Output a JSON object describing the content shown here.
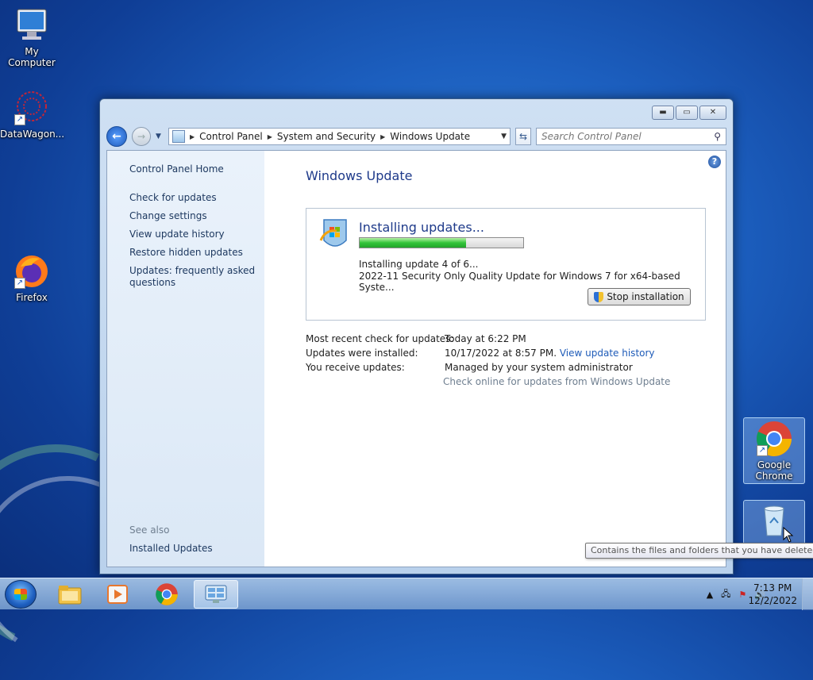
{
  "desktop": {
    "icons": [
      {
        "label": "My Computer",
        "icon": "computer-icon"
      },
      {
        "label": "DataWagon...",
        "icon": "datawagon-icon"
      },
      {
        "label": "Firefox",
        "icon": "firefox-icon"
      },
      {
        "label": "Google Chrome",
        "icon": "chrome-icon"
      },
      {
        "label": "",
        "icon": "recycle-bin-icon"
      }
    ],
    "tooltip": "Contains the files and folders that you have deleted."
  },
  "window": {
    "breadcrumb": [
      "Control Panel",
      "System and Security",
      "Windows Update"
    ],
    "search_placeholder": "Search Control Panel",
    "left_pane": {
      "home": "Control Panel Home",
      "links": [
        "Check for updates",
        "Change settings",
        "View update history",
        "Restore hidden updates",
        "Updates: frequently asked questions"
      ],
      "see_also": "See also",
      "see_also_links": [
        "Installed Updates"
      ]
    },
    "main": {
      "title": "Windows Update",
      "status_title": "Installing updates...",
      "progress": 0.65,
      "progress_text": "Installing update 4 of 6...",
      "update_name": "2022-11 Security Only Quality Update for Windows 7 for x64-based Syste...",
      "stop_button": "Stop installation",
      "info": [
        {
          "label": "Most recent check for updates:",
          "value": "Today at 6:22 PM"
        },
        {
          "label": "Updates were installed:",
          "value": "10/17/2022 at 8:57 PM.",
          "link": "View update history"
        },
        {
          "label": "You receive updates:",
          "value": "Managed by your system administrator"
        }
      ],
      "online_link": "Check online for updates from Windows Update"
    }
  },
  "taskbar": {
    "time": "7:13 PM",
    "date": "12/2/2022"
  },
  "colors": {
    "accent": "#1e3a8a",
    "link": "#1e5bb8",
    "progress": "#33c43a"
  }
}
